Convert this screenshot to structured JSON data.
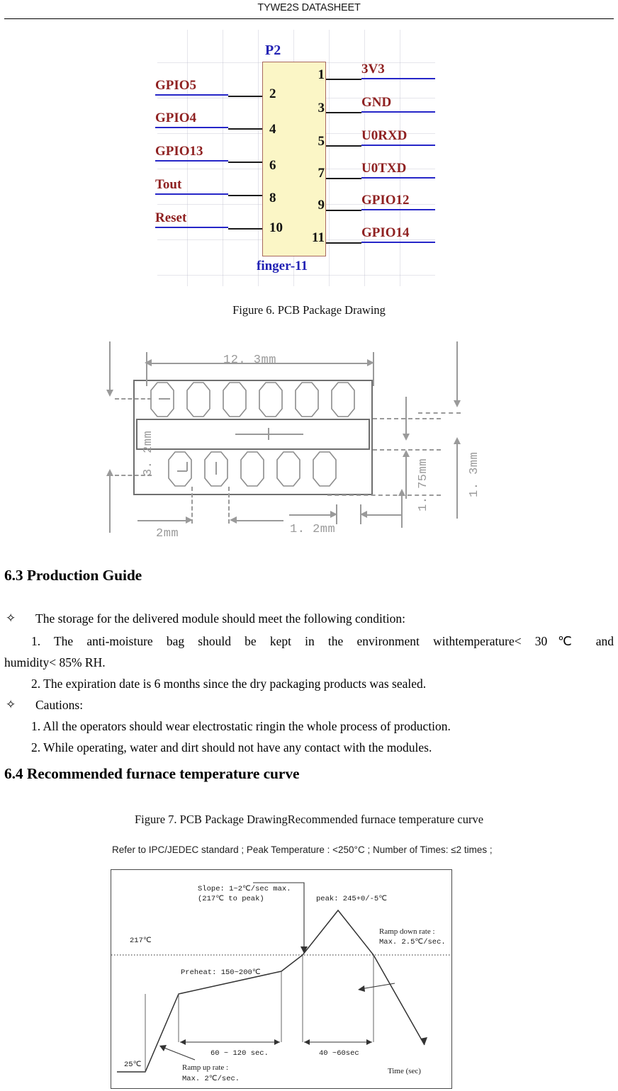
{
  "header": {
    "title": "TYWE2S DATASHEET"
  },
  "figure6": {
    "caption": "Figure 6. PCB Package Drawing",
    "chip_label": "P2",
    "chip_footer": "finger-11",
    "left_pins": [
      {
        "num": "2",
        "signal": "GPIO5"
      },
      {
        "num": "4",
        "signal": "GPIO4"
      },
      {
        "num": "6",
        "signal": "GPIO13"
      },
      {
        "num": "8",
        "signal": "Tout"
      },
      {
        "num": "10",
        "signal": "Reset"
      }
    ],
    "right_pins": [
      {
        "num": "1",
        "signal": "3V3"
      },
      {
        "num": "3",
        "signal": "GND"
      },
      {
        "num": "5",
        "signal": "U0RXD"
      },
      {
        "num": "7",
        "signal": "U0TXD"
      },
      {
        "num": "9",
        "signal": "GPIO12"
      },
      {
        "num": "11",
        "signal": "GPIO14"
      }
    ],
    "colors": {
      "body_fill": "#fbf6c6",
      "body_border": "#a8695f",
      "signal_text": "#8f2121",
      "signal_underline": "#2626c8",
      "title_text": "#2222b4"
    }
  },
  "dimensions": {
    "width_mm": "12. 3mm",
    "height_mm": "3. 2mm",
    "pad_pitch_mm": "2mm",
    "pad_width_mm": "1. 2mm",
    "inner_mm": "1. 75mm",
    "edge_mm": "1. 3mm",
    "top_pad_count": 6,
    "bottom_pad_count": 5
  },
  "sections": {
    "production": {
      "heading": "6.3 Production Guide",
      "bullet1": "The storage for the delivered module should meet the following condition:",
      "item1a": "1. The anti-moisture bag should be kept in the environment withtemperature< 30℃ and",
      "item1b": "humidity< 85% RH.",
      "item2": "2. The expiration date is 6 months since the dry packaging products was sealed.",
      "bullet2": "Cautions:",
      "caution1": "1. All the operators should wear electrostatic ringin the whole process of production.",
      "caution2": "2. While operating, water and dirt should not have any contact with the modules.",
      "bullet_glyph": "✧"
    },
    "furnace": {
      "heading": "6.4 Recommended furnace temperature curve",
      "caption": "Figure 7. PCB Package DrawingRecommended furnace temperature curve"
    }
  },
  "chart_data": {
    "type": "line",
    "title": "Refer to IPC/JEDEC standard ; Peak Temperature : <250°C ; Number of Times:  ≤2 times ;",
    "xlabel": "Time (sec)",
    "ylabel": "",
    "series": [
      {
        "name": "Reflow temperature profile",
        "x": [
          0,
          32,
          52,
          175,
          225,
          290,
          345,
          430
        ],
        "y": [
          25,
          25,
          150,
          200,
          217,
          245,
          217,
          60
        ]
      }
    ],
    "reference_lines": [
      {
        "label": "217℃",
        "value": 217,
        "style": "dotted"
      }
    ],
    "axis_labels": [
      {
        "label": "217℃",
        "value": 217
      },
      {
        "label": "25℃",
        "value": 25
      }
    ],
    "annotations": [
      {
        "name": "slope",
        "line1": "Slope: 1~2℃/sec max.",
        "line2": "(217℃ to peak)"
      },
      {
        "name": "peak",
        "line1": "peak: 245+0/-5℃",
        "line2": ""
      },
      {
        "name": "ramp-down",
        "line1": "Ramp down rate :",
        "line2": "Max. 2.5℃/sec."
      },
      {
        "name": "preheat",
        "line1": "Preheat: 150~200℃",
        "line2": ""
      },
      {
        "name": "ramp-up",
        "line1": "Ramp up rate :",
        "line2": "Max. 2℃/sec."
      }
    ],
    "time_spans": [
      {
        "label": "60 ~ 120 sec.",
        "from": 52,
        "to": 175
      },
      {
        "label": "40 ~60sec",
        "from": 225,
        "to": 345
      }
    ]
  }
}
